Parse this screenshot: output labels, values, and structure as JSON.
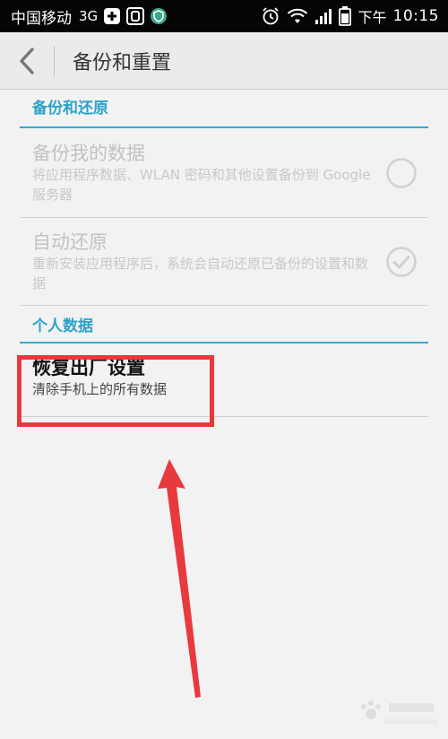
{
  "status_bar": {
    "carrier": "中国移动",
    "network": "3G",
    "ampm": "下午",
    "time": "10:15",
    "icons": [
      "notification-plus-icon",
      "notification-square-icon",
      "shield-app-icon",
      "alarm-icon",
      "wifi-icon",
      "signal-icon",
      "battery-icon"
    ]
  },
  "action_bar": {
    "back_icon": "chevron-left-icon",
    "title": "备份和重置"
  },
  "sections": [
    {
      "header": "备份和还原",
      "items": [
        {
          "title": "备份我的数据",
          "summary": "将应用程序数据、WLAN 密码和其他设置备份到 Google 服务器",
          "enabled": false,
          "checked": false
        },
        {
          "title": "自动还原",
          "summary": "重新安装应用程序后，系统会自动还原已备份的设置和数据",
          "enabled": false,
          "checked": true
        }
      ]
    },
    {
      "header": "个人数据",
      "items": [
        {
          "title": "恢复出厂设置",
          "summary": "清除手机上的所有数据",
          "enabled": true
        }
      ]
    }
  ],
  "annotation": {
    "highlight_color": "#e8393e",
    "arrow_color": "#e8393e"
  },
  "colors": {
    "accent": "#36a9d1",
    "status_bar_bg": "#050505",
    "action_bar_bg": "#ebebeb"
  }
}
